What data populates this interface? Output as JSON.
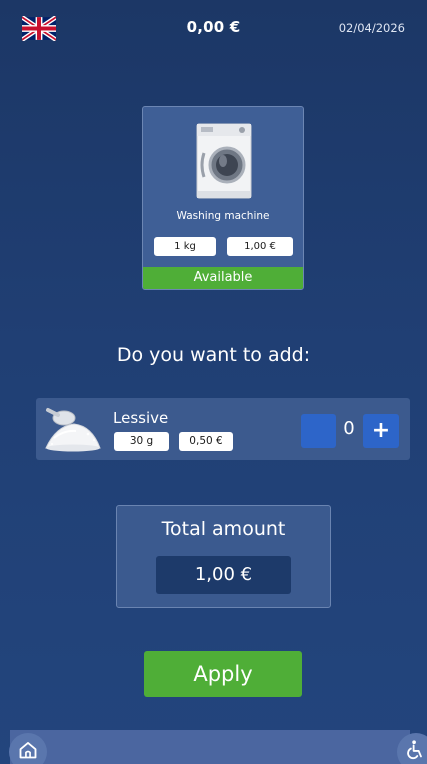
{
  "header": {
    "balance": "0,00 €",
    "date": "02/04/2026",
    "language_flag_icon": "uk-flag-icon"
  },
  "machine": {
    "name": "Washing machine",
    "capacity": "1 kg",
    "price": "1,00 €",
    "status": "Available",
    "image_icon": "washing-machine-icon"
  },
  "addons": {
    "question": "Do you want to add:",
    "items": [
      {
        "name": "Lessive",
        "weight": "30 g",
        "price": "0,50 €",
        "quantity": "0",
        "plus_label": "+",
        "image_icon": "detergent-powder-icon"
      }
    ]
  },
  "total": {
    "label": "Total amount",
    "value": "1,00 €"
  },
  "actions": {
    "apply_label": "Apply"
  },
  "footer": {
    "home_icon": "home-icon",
    "accessibility_icon": "accessibility-icon"
  },
  "colors": {
    "background": "#1f3d70",
    "card": "#3f5f96",
    "green": "#4fae37",
    "button_blue": "#2d65c9"
  }
}
